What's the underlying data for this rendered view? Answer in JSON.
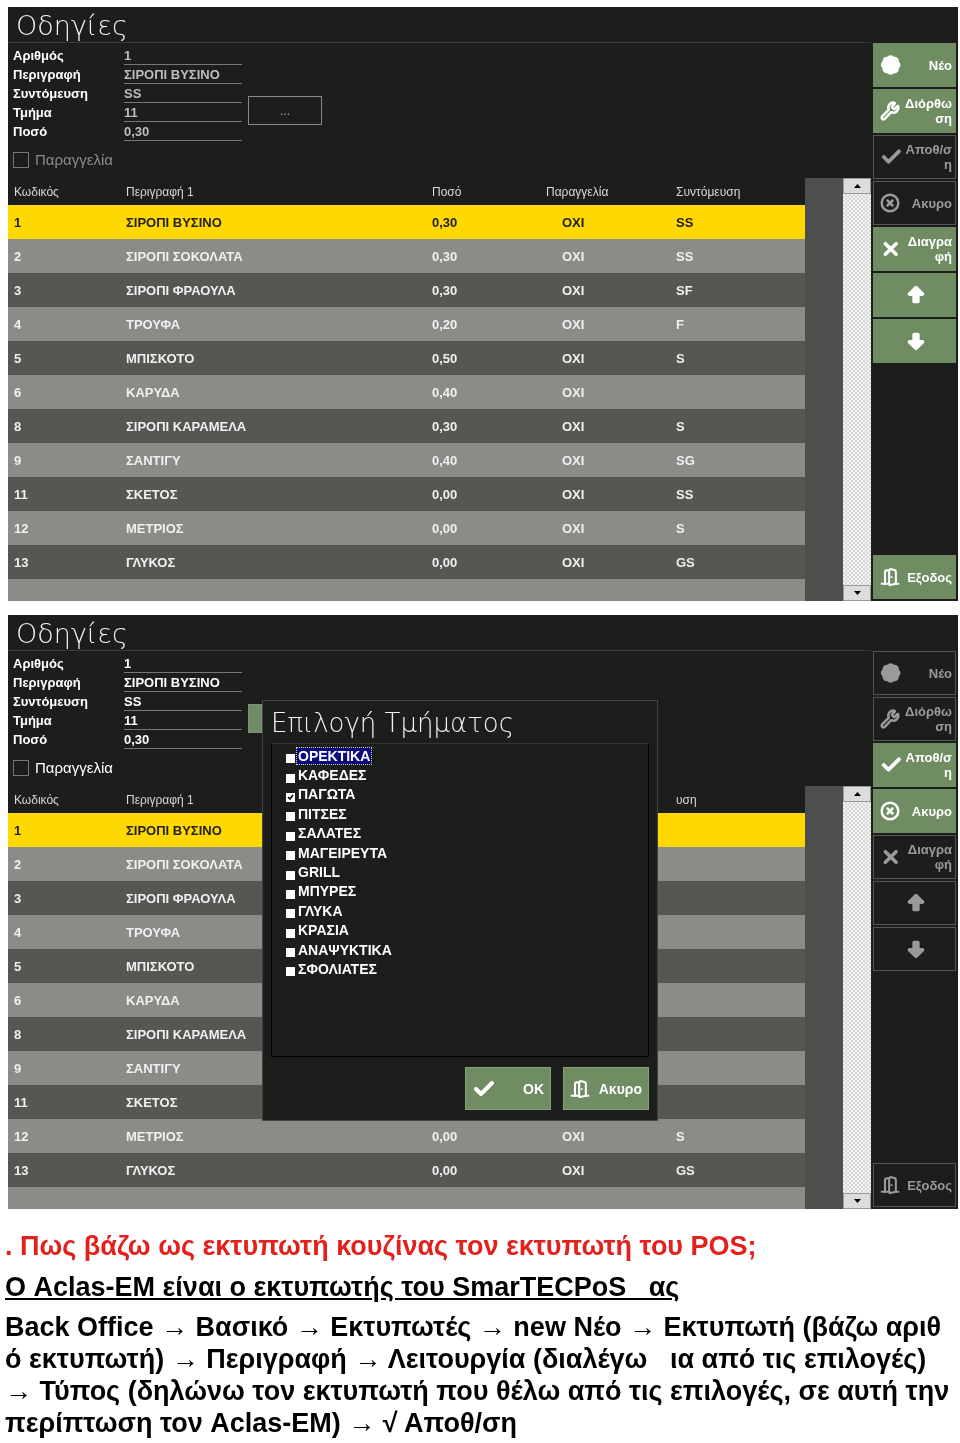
{
  "panels": [
    {
      "title": "Οδηγίες",
      "form": {
        "disabled": true,
        "fields": [
          {
            "label": "Αριθμός",
            "value": "1"
          },
          {
            "label": "Περιγραφή",
            "value": "ΣΙΡΟΠΙ ΒΥΣΙΝΟ"
          },
          {
            "label": "Συντόμευση",
            "value": "SS"
          },
          {
            "label": "Τμήμα",
            "value": "11"
          },
          {
            "label": "Ποσό",
            "value": "0,30"
          }
        ],
        "browse_button": {
          "label": "...",
          "enabled": false
        },
        "order_checkbox": {
          "label": "Παραγγελία",
          "checked": false
        }
      },
      "table": {
        "header": {
          "code": "Κωδικός",
          "description": "Περιγραφή 1",
          "qty": "Ποσό",
          "order": "Παραγγελία",
          "short": "Συντόμευση"
        },
        "rows": [
          {
            "code": "1",
            "description": "ΣΙΡΟΠΙ ΒΥΣΙΝΟ",
            "qty": "0,30",
            "order": "ΟΧΙ",
            "short": "SS",
            "selected": true
          },
          {
            "code": "2",
            "description": "ΣΙΡΟΠΙ ΣΟΚΟΛΑΤΑ",
            "qty": "0,30",
            "order": "ΟΧΙ",
            "short": "SS",
            "selected": false
          },
          {
            "code": "3",
            "description": "ΣΙΡΟΠΙ ΦΡΑΟΥΛΑ",
            "qty": "0,30",
            "order": "ΟΧΙ",
            "short": "SF",
            "selected": false
          },
          {
            "code": "4",
            "description": "ΤΡΟΥΦΑ",
            "qty": "0,20",
            "order": "ΟΧΙ",
            "short": "F",
            "selected": false
          },
          {
            "code": "5",
            "description": "ΜΠΙΣΚΟΤΟ",
            "qty": "0,50",
            "order": "ΟΧΙ",
            "short": "S",
            "selected": false
          },
          {
            "code": "6",
            "description": "ΚΑΡΥΔΑ",
            "qty": "0,40",
            "order": "ΟΧΙ",
            "selected": false
          },
          {
            "code": "8",
            "description": "ΣΙΡΟΠΙ ΚΑΡΑΜΕΛΑ",
            "qty": "0,30",
            "order": "ΟΧΙ",
            "short": "S",
            "selected": false
          },
          {
            "code": "9",
            "description": "ΣΑΝΤΙΓΥ",
            "qty": "0,40",
            "order": "ΟΧΙ",
            "short": "SG",
            "selected": false
          },
          {
            "code": "11",
            "description": "ΣΚΕΤΟΣ",
            "qty": "0,00",
            "order": "ΟΧΙ",
            "short": "SS",
            "selected": false
          },
          {
            "code": "12",
            "description": "ΜΕΤΡΙΟΣ",
            "qty": "0,00",
            "order": "ΟΧΙ",
            "short": "S",
            "selected": false
          },
          {
            "code": "13",
            "description": "ΓΛΥΚΟΣ",
            "qty": "0,00",
            "order": "ΟΧΙ",
            "short": "GS",
            "selected": false
          }
        ]
      },
      "buttons": [
        {
          "kind": "new",
          "label": "Νέο",
          "enabled": true
        },
        {
          "kind": "edit",
          "label": "Διόρθωση",
          "enabled": true
        },
        {
          "kind": "save",
          "label": "Αποθ/ση",
          "enabled": false
        },
        {
          "kind": "cancel",
          "label": "Ακυρο",
          "enabled": false
        },
        {
          "kind": "delete",
          "label": "Διαγραφή",
          "enabled": true
        },
        {
          "kind": "up",
          "enabled": true
        },
        {
          "kind": "down",
          "enabled": true
        },
        {
          "kind": "exit",
          "label": "Εξοδος",
          "enabled": true
        }
      ]
    },
    {
      "title": "Οδηγίες",
      "form": {
        "disabled": false,
        "fields": [
          {
            "label": "Αριθμός",
            "value": "1"
          },
          {
            "label": "Περιγραφή",
            "value": "ΣΙΡΟΠΙ ΒΥΣΙΝΟ"
          },
          {
            "label": "Συντόμευση",
            "value": "SS"
          },
          {
            "label": "Τμήμα",
            "value": "11"
          },
          {
            "label": "Ποσό",
            "value": "0,30"
          }
        ],
        "browse_button": {
          "enabled": true
        },
        "order_checkbox": {
          "label": "Παραγγελία",
          "checked": false
        }
      },
      "table": {
        "header": {
          "code": "Κωδικός",
          "description": "Περιγραφή 1",
          "short": "υση"
        },
        "rows": [
          {
            "code": "1",
            "description": "ΣΙΡΟΠΙ ΒΥΣΙΝΟ",
            "selected": true
          },
          {
            "code": "2",
            "description": "ΣΙΡΟΠΙ ΣΟΚΟΛΑΤΑ",
            "selected": false
          },
          {
            "code": "3",
            "description": "ΣΙΡΟΠΙ ΦΡΑΟΥΛΑ",
            "selected": false
          },
          {
            "code": "4",
            "description": "ΤΡΟΥΦΑ",
            "selected": false
          },
          {
            "code": "5",
            "description": "ΜΠΙΣΚΟΤΟ",
            "selected": false
          },
          {
            "code": "6",
            "description": "ΚΑΡΥΔΑ",
            "selected": false
          },
          {
            "code": "8",
            "description": "ΣΙΡΟΠΙ ΚΑΡΑΜΕΛΑ",
            "selected": false
          },
          {
            "code": "9",
            "description": "ΣΑΝΤΙΓΥ",
            "selected": false
          },
          {
            "code": "11",
            "description": "ΣΚΕΤΟΣ",
            "selected": false
          },
          {
            "code": "12",
            "description": "ΜΕΤΡΙΟΣ",
            "qty": "0,00",
            "order": "ΟΧΙ",
            "short": "S",
            "selected": false
          },
          {
            "code": "13",
            "description": "ΓΛΥΚΟΣ",
            "qty": "0,00",
            "order": "ΟΧΙ",
            "short": "GS",
            "selected": false
          }
        ]
      },
      "buttons": [
        {
          "kind": "new",
          "label": "Νέο",
          "enabled": false
        },
        {
          "kind": "edit",
          "label": "Διόρθωση",
          "enabled": false
        },
        {
          "kind": "save",
          "label": "Αποθ/ση",
          "enabled": true
        },
        {
          "kind": "cancel",
          "label": "Ακυρο",
          "enabled": true
        },
        {
          "kind": "delete",
          "label": "Διαγραφή",
          "enabled": false
        },
        {
          "kind": "up",
          "enabled": false
        },
        {
          "kind": "down",
          "enabled": false
        },
        {
          "kind": "exit",
          "label": "Εξοδος",
          "enabled": false
        }
      ],
      "dialog": {
        "title": "Επιλογή Τμήματος",
        "items": [
          {
            "label": "ΟΡΕΚΤΙΚΑ",
            "checked": false,
            "selected": true
          },
          {
            "label": "ΚΑΦΕΔΕΣ",
            "checked": false,
            "selected": false
          },
          {
            "label": "ΠΑΓΩΤΑ",
            "checked": true,
            "selected": false
          },
          {
            "label": "ΠΙΤΣΕΣ",
            "checked": false,
            "selected": false
          },
          {
            "label": "ΣΑΛΑΤΕΣ",
            "checked": false,
            "selected": false
          },
          {
            "label": "ΜΑΓΕΙΡΕΥΤΑ",
            "checked": false,
            "selected": false
          },
          {
            "label": "GRILL",
            "checked": false,
            "selected": false
          },
          {
            "label": "ΜΠΥΡΕΣ",
            "checked": false,
            "selected": false
          },
          {
            "label": "ΓΛΥΚΑ",
            "checked": false,
            "selected": false
          },
          {
            "label": "ΚΡΑΣΙΑ",
            "checked": false,
            "selected": false
          },
          {
            "label": "ΑΝΑΨΥΚΤΙΚΑ",
            "checked": false,
            "selected": false
          },
          {
            "label": "ΣΦΟΛΙΑΤΕΣ",
            "checked": false,
            "selected": false
          }
        ],
        "buttons": [
          {
            "kind": "ok",
            "label": "OK"
          },
          {
            "kind": "cancel",
            "label": "Ακυρο"
          }
        ]
      }
    }
  ],
  "note": {
    "question": ". Πως βάζω ως εκτυπωτή κουζίνας τον εκτυπωτή του POS;",
    "subtitle": "Ο Aclas-EM είναι ο εκτυπωτής του SmarTECPoS   ας",
    "steps": "Back Office → Βασικό → Εκτυπωτές → new Νέο → Εκτυπωτή (βάζω αριθ  ό εκτυπωτή) → Περιγραφή → Λειτουργία (διαλέγω   ια από τις επιλογές) → Τύπος (δηλώνω τον εκτυπωτή που θέλω από τις επιλογές, σε αυτή την περίπτωση τον Aclas-EM) → √ Αποθ/ση"
  }
}
